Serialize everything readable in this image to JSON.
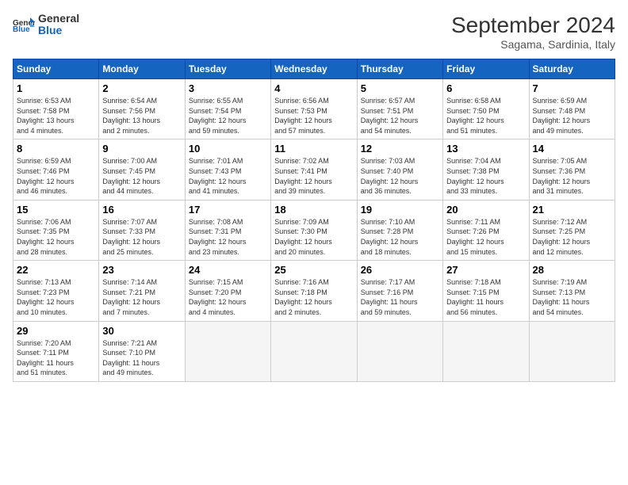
{
  "header": {
    "logo_general": "General",
    "logo_blue": "Blue",
    "month_title": "September 2024",
    "subtitle": "Sagama, Sardinia, Italy"
  },
  "days_of_week": [
    "Sunday",
    "Monday",
    "Tuesday",
    "Wednesday",
    "Thursday",
    "Friday",
    "Saturday"
  ],
  "weeks": [
    [
      {
        "num": "1",
        "info": "Sunrise: 6:53 AM\nSunset: 7:58 PM\nDaylight: 13 hours\nand 4 minutes."
      },
      {
        "num": "2",
        "info": "Sunrise: 6:54 AM\nSunset: 7:56 PM\nDaylight: 13 hours\nand 2 minutes."
      },
      {
        "num": "3",
        "info": "Sunrise: 6:55 AM\nSunset: 7:54 PM\nDaylight: 12 hours\nand 59 minutes."
      },
      {
        "num": "4",
        "info": "Sunrise: 6:56 AM\nSunset: 7:53 PM\nDaylight: 12 hours\nand 57 minutes."
      },
      {
        "num": "5",
        "info": "Sunrise: 6:57 AM\nSunset: 7:51 PM\nDaylight: 12 hours\nand 54 minutes."
      },
      {
        "num": "6",
        "info": "Sunrise: 6:58 AM\nSunset: 7:50 PM\nDaylight: 12 hours\nand 51 minutes."
      },
      {
        "num": "7",
        "info": "Sunrise: 6:59 AM\nSunset: 7:48 PM\nDaylight: 12 hours\nand 49 minutes."
      }
    ],
    [
      {
        "num": "8",
        "info": "Sunrise: 6:59 AM\nSunset: 7:46 PM\nDaylight: 12 hours\nand 46 minutes."
      },
      {
        "num": "9",
        "info": "Sunrise: 7:00 AM\nSunset: 7:45 PM\nDaylight: 12 hours\nand 44 minutes."
      },
      {
        "num": "10",
        "info": "Sunrise: 7:01 AM\nSunset: 7:43 PM\nDaylight: 12 hours\nand 41 minutes."
      },
      {
        "num": "11",
        "info": "Sunrise: 7:02 AM\nSunset: 7:41 PM\nDaylight: 12 hours\nand 39 minutes."
      },
      {
        "num": "12",
        "info": "Sunrise: 7:03 AM\nSunset: 7:40 PM\nDaylight: 12 hours\nand 36 minutes."
      },
      {
        "num": "13",
        "info": "Sunrise: 7:04 AM\nSunset: 7:38 PM\nDaylight: 12 hours\nand 33 minutes."
      },
      {
        "num": "14",
        "info": "Sunrise: 7:05 AM\nSunset: 7:36 PM\nDaylight: 12 hours\nand 31 minutes."
      }
    ],
    [
      {
        "num": "15",
        "info": "Sunrise: 7:06 AM\nSunset: 7:35 PM\nDaylight: 12 hours\nand 28 minutes."
      },
      {
        "num": "16",
        "info": "Sunrise: 7:07 AM\nSunset: 7:33 PM\nDaylight: 12 hours\nand 25 minutes."
      },
      {
        "num": "17",
        "info": "Sunrise: 7:08 AM\nSunset: 7:31 PM\nDaylight: 12 hours\nand 23 minutes."
      },
      {
        "num": "18",
        "info": "Sunrise: 7:09 AM\nSunset: 7:30 PM\nDaylight: 12 hours\nand 20 minutes."
      },
      {
        "num": "19",
        "info": "Sunrise: 7:10 AM\nSunset: 7:28 PM\nDaylight: 12 hours\nand 18 minutes."
      },
      {
        "num": "20",
        "info": "Sunrise: 7:11 AM\nSunset: 7:26 PM\nDaylight: 12 hours\nand 15 minutes."
      },
      {
        "num": "21",
        "info": "Sunrise: 7:12 AM\nSunset: 7:25 PM\nDaylight: 12 hours\nand 12 minutes."
      }
    ],
    [
      {
        "num": "22",
        "info": "Sunrise: 7:13 AM\nSunset: 7:23 PM\nDaylight: 12 hours\nand 10 minutes."
      },
      {
        "num": "23",
        "info": "Sunrise: 7:14 AM\nSunset: 7:21 PM\nDaylight: 12 hours\nand 7 minutes."
      },
      {
        "num": "24",
        "info": "Sunrise: 7:15 AM\nSunset: 7:20 PM\nDaylight: 12 hours\nand 4 minutes."
      },
      {
        "num": "25",
        "info": "Sunrise: 7:16 AM\nSunset: 7:18 PM\nDaylight: 12 hours\nand 2 minutes."
      },
      {
        "num": "26",
        "info": "Sunrise: 7:17 AM\nSunset: 7:16 PM\nDaylight: 11 hours\nand 59 minutes."
      },
      {
        "num": "27",
        "info": "Sunrise: 7:18 AM\nSunset: 7:15 PM\nDaylight: 11 hours\nand 56 minutes."
      },
      {
        "num": "28",
        "info": "Sunrise: 7:19 AM\nSunset: 7:13 PM\nDaylight: 11 hours\nand 54 minutes."
      }
    ],
    [
      {
        "num": "29",
        "info": "Sunrise: 7:20 AM\nSunset: 7:11 PM\nDaylight: 11 hours\nand 51 minutes."
      },
      {
        "num": "30",
        "info": "Sunrise: 7:21 AM\nSunset: 7:10 PM\nDaylight: 11 hours\nand 49 minutes."
      },
      {
        "num": "",
        "info": ""
      },
      {
        "num": "",
        "info": ""
      },
      {
        "num": "",
        "info": ""
      },
      {
        "num": "",
        "info": ""
      },
      {
        "num": "",
        "info": ""
      }
    ]
  ]
}
